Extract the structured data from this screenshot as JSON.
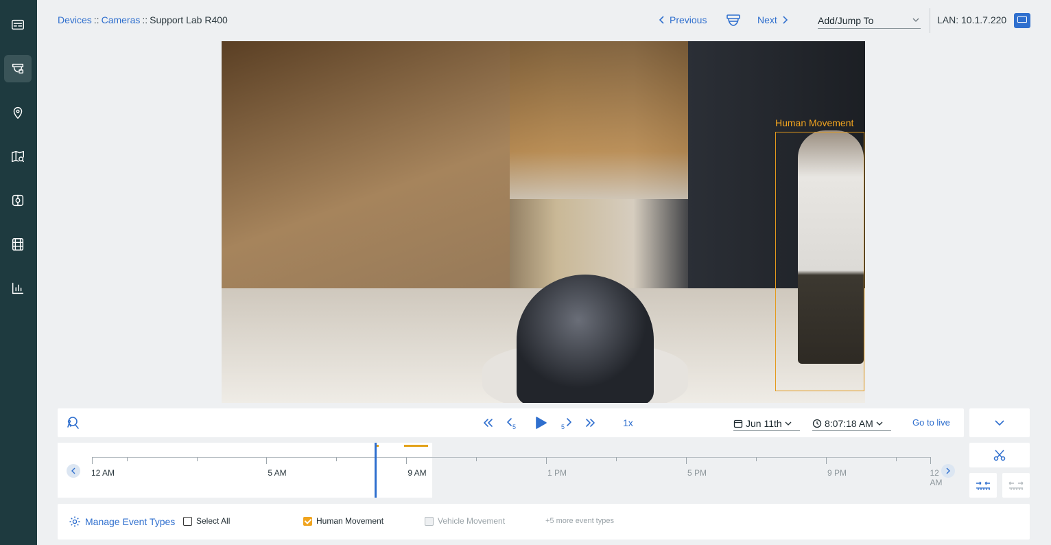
{
  "breadcrumb": {
    "devices": "Devices",
    "cameras": "Cameras",
    "camera": "Support Lab R400",
    "separator": "::"
  },
  "nav": {
    "previous": "Previous",
    "next": "Next",
    "jump_label": "Add/Jump To",
    "lan": "LAN: 10.1.7.220"
  },
  "sidebar": {
    "items": [
      {
        "name": "dashboard-icon"
      },
      {
        "name": "camera-icon",
        "active": true
      },
      {
        "name": "location-pin-icon"
      },
      {
        "name": "map-search-icon"
      },
      {
        "name": "access-control-icon"
      },
      {
        "name": "film-icon"
      },
      {
        "name": "bar-chart-icon"
      }
    ]
  },
  "video": {
    "detection_label": "Human Movement"
  },
  "controls": {
    "speed": "1x",
    "date": "Jun 11th",
    "time": "8:07:18 AM",
    "go_live": "Go to live"
  },
  "timeline": {
    "labels": [
      "12 AM",
      "5 AM",
      "9 AM",
      "1 PM",
      "5 PM",
      "9 PM",
      "12 AM"
    ],
    "event_color": "#e3a21a",
    "playhead_color": "#2f6fce"
  },
  "events": {
    "manage": "Manage Event Types",
    "select_all": "Select All",
    "types": [
      {
        "label": "Human Movement",
        "checked": true,
        "enabled": true
      },
      {
        "label": "Vehicle Movement",
        "checked": false,
        "enabled": false
      }
    ],
    "more": "+5 more event types"
  },
  "colors": {
    "accent": "#2f6fce",
    "sidebar": "#1e3a3f",
    "event": "#f0a41e"
  }
}
